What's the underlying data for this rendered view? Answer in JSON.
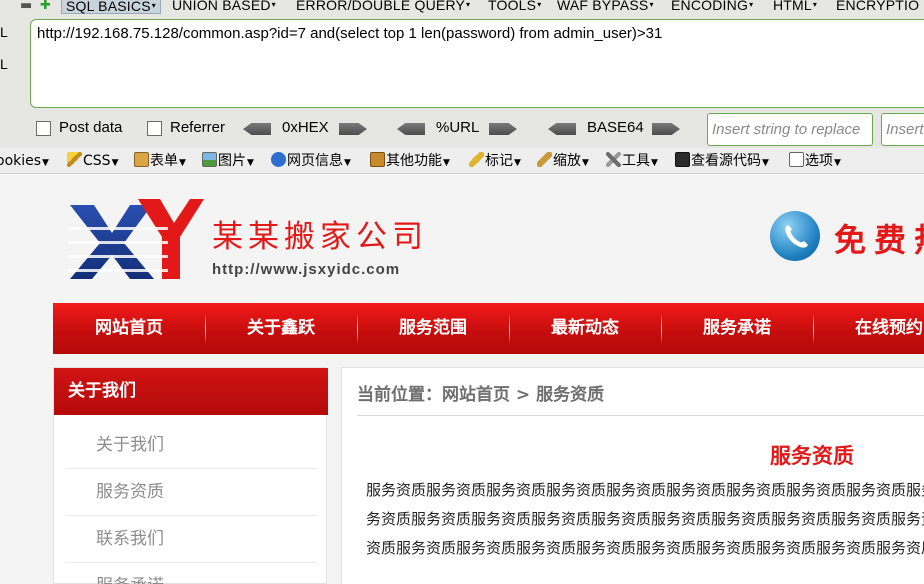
{
  "hackbar": {
    "menu": [
      {
        "label": "SQL BASICS",
        "active": true
      },
      {
        "label": "UNION BASED"
      },
      {
        "label": "ERROR/DOUBLE QUERY"
      },
      {
        "label": "TOOLS"
      },
      {
        "label": "WAF BYPASS"
      },
      {
        "label": "ENCODING"
      },
      {
        "label": "HTML"
      },
      {
        "label": "ENCRYPTIO"
      }
    ],
    "side_letters": [
      "L",
      "L"
    ],
    "url": "http://192.168.75.128/common.asp?id=7 and(select top 1 len(password) from admin_user)>31",
    "post_data_label": "Post data",
    "referrer_label": "Referrer",
    "hex_label": "0xHEX",
    "url_label": "%URL",
    "base64_label": "BASE64",
    "replace_placeholder": "Insert string to replace",
    "replace_with_placeholder": "Insert"
  },
  "devbar": {
    "items": [
      {
        "label": "ookies",
        "icon": "none"
      },
      {
        "label": "CSS",
        "icon": "pencil-icon"
      },
      {
        "label": "表单",
        "icon": "form-icon"
      },
      {
        "label": "图片",
        "icon": "image-icon"
      },
      {
        "label": "网页信息",
        "icon": "info-icon"
      },
      {
        "label": "其他功能",
        "icon": "misc-icon"
      },
      {
        "label": "标记",
        "icon": "marker-icon"
      },
      {
        "label": "缩放",
        "icon": "resize-icon"
      },
      {
        "label": "工具",
        "icon": "tools-icon"
      },
      {
        "label": "查看源代码",
        "icon": "source-icon"
      },
      {
        "label": "选项",
        "icon": "options-icon"
      }
    ]
  },
  "site": {
    "brand_name": "某某搬家公司",
    "brand_url": "http://www.jsxyidc.com",
    "phone_text": "免费热",
    "nav": [
      "网站首页",
      "关于鑫跃",
      "服务范围",
      "最新动态",
      "服务承诺",
      "在线预约"
    ],
    "sidebar_title": "关于我们",
    "sidebar_items": [
      "关于我们",
      "服务资质",
      "联系我们",
      "服务承诺"
    ],
    "breadcrumb": "当前位置：网站首页 > 服务资质",
    "content_title": "服务资质",
    "content_lines": [
      "服务资质服务资质服务资质服务资质服务资质服务资质服务资质服务资质服务资质服务资质",
      "务资质服务资质服务资质服务资质服务资质服务资质服务资质服务资质服务资质服务资质服",
      "资质服务资质服务资质服务资质服务资质服务资质服务资质服务资质服务资质服务资质服务"
    ],
    "colors": {
      "brand_red": "#e31818",
      "nav_red": "#d11313",
      "logo_blue": "#1f3e99"
    }
  }
}
